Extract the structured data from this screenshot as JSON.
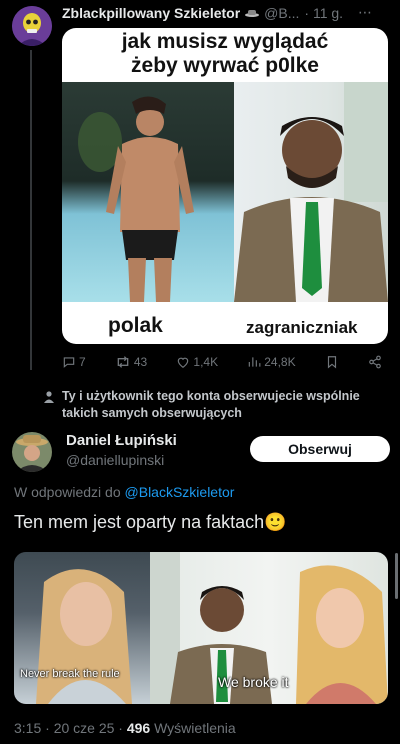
{
  "post": {
    "display_name": "Zblackpillowany Szkieletor",
    "handle": "@B...",
    "time": "· 11 g.",
    "meme": {
      "title_line1": "jak musisz wyglądać",
      "title_line2": "żeby wyrwać p0lke",
      "caption_left": "polak",
      "caption_right": "zagraniczniak"
    },
    "actions": {
      "replies": "7",
      "reposts": "43",
      "likes": "1,4K",
      "views": "24,8K"
    }
  },
  "mutual_notice": "Ty i użytkownik tego konta obserwujecie wspólnie takich samych obserwujących",
  "reply": {
    "display_name": "Daniel Łupiński",
    "handle": "@daniellupinski",
    "follow_label": "Obserwuj",
    "in_reply_prefix": "W odpowiedzi do",
    "in_reply_handle": "@BlackSzkieletor",
    "text": "Ten mem jest oparty na faktach",
    "emoji": "🙂",
    "media": {
      "overlay_left": "Never break the rule",
      "overlay_right": "We broke it"
    },
    "meta": {
      "time_date": "3:15 · 20 cze 25 ·",
      "views_count": "496",
      "views_label": "Wyświetlenia"
    }
  },
  "colors": {
    "background": "#000000",
    "text": "#e7e9ea",
    "muted": "#71767b",
    "link": "#1d9bf0",
    "follow_button": "#ffffff"
  }
}
